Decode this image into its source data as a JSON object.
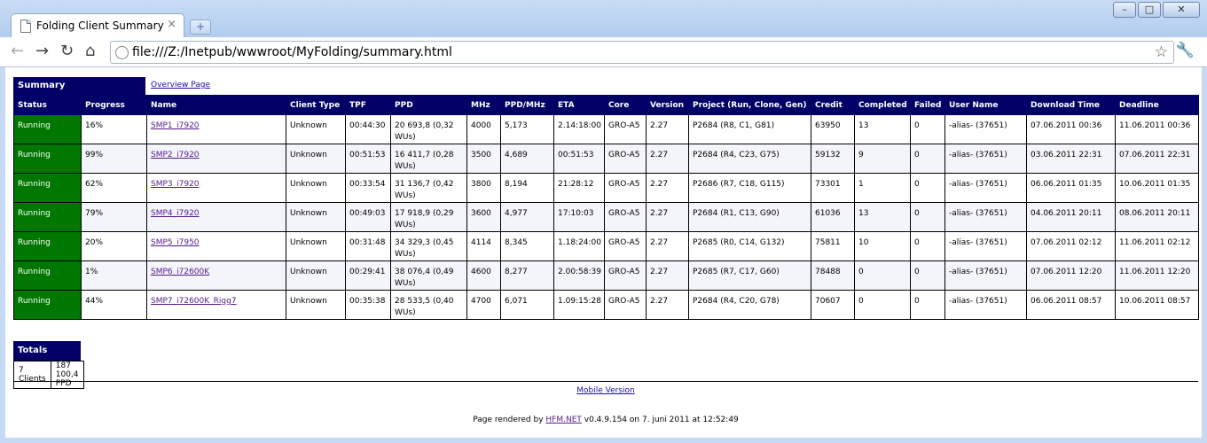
{
  "browser": {
    "tab_title": "Folding Client Summary",
    "tab_close": "×",
    "new_tab": "+",
    "url": "file:///Z:/Inetpub/wwwroot/MyFolding/summary.html",
    "icons": [
      "back-icon",
      "forward-icon",
      "reload-icon",
      "home-icon",
      "globe-icon",
      "star-icon",
      "wrench-icon"
    ]
  },
  "summary": {
    "title": "Summary",
    "overview_link": "Overview Page"
  },
  "columns": [
    "Status",
    "Progress",
    "Name",
    "Client Type",
    "TPF",
    "PPD",
    "MHz",
    "PPD/MHz",
    "ETA",
    "Core",
    "Version",
    "Project (Run, Clone, Gen)",
    "Credit",
    "Completed",
    "Failed",
    "User Name",
    "Download Time",
    "Deadline"
  ],
  "rows": [
    {
      "status": "Running",
      "progress": "16%",
      "name": "SMP1_i7920",
      "client_type": "Unknown",
      "tpf": "00:44:30",
      "ppd": "20 693,8 (0,32 WUs)",
      "mhz": "4000",
      "ppd_mhz": "5,173",
      "eta": "2.14:18:00",
      "core": "GRO-A5",
      "version": "2.27",
      "project": "P2684 (R8, C1, G81)",
      "credit": "63950",
      "completed": "13",
      "failed": "0",
      "user": "-alias- (37651)",
      "download": "07.06.2011 00:36",
      "deadline": "11.06.2011 00:36"
    },
    {
      "status": "Running",
      "progress": "99%",
      "name": "SMP2_i7920",
      "client_type": "Unknown",
      "tpf": "00:51:53",
      "ppd": "16 411,7 (0,28 WUs)",
      "mhz": "3500",
      "ppd_mhz": "4,689",
      "eta": "00:51:53",
      "core": "GRO-A5",
      "version": "2.27",
      "project": "P2684 (R4, C23, G75)",
      "credit": "59132",
      "completed": "9",
      "failed": "0",
      "user": "-alias- (37651)",
      "download": "03.06.2011 22:31",
      "deadline": "07.06.2011 22:31"
    },
    {
      "status": "Running",
      "progress": "62%",
      "name": "SMP3_i7920",
      "client_type": "Unknown",
      "tpf": "00:33:54",
      "ppd": "31 136,7 (0,42 WUs)",
      "mhz": "3800",
      "ppd_mhz": "8,194",
      "eta": "21:28:12",
      "core": "GRO-A5",
      "version": "2.27",
      "project": "P2686 (R7, C18, G115)",
      "credit": "73301",
      "completed": "1",
      "failed": "0",
      "user": "-alias- (37651)",
      "download": "06.06.2011 01:35",
      "deadline": "10.06.2011 01:35"
    },
    {
      "status": "Running",
      "progress": "79%",
      "name": "SMP4_i7920",
      "client_type": "Unknown",
      "tpf": "00:49:03",
      "ppd": "17 918,9 (0,29 WUs)",
      "mhz": "3600",
      "ppd_mhz": "4,977",
      "eta": "17:10:03",
      "core": "GRO-A5",
      "version": "2.27",
      "project": "P2684 (R1, C13, G90)",
      "credit": "61036",
      "completed": "13",
      "failed": "0",
      "user": "-alias- (37651)",
      "download": "04.06.2011 20:11",
      "deadline": "08.06.2011 20:11"
    },
    {
      "status": "Running",
      "progress": "20%",
      "name": "SMP5_i7950",
      "client_type": "Unknown",
      "tpf": "00:31:48",
      "ppd": "34 329,3 (0,45 WUs)",
      "mhz": "4114",
      "ppd_mhz": "8,345",
      "eta": "1.18:24:00",
      "core": "GRO-A5",
      "version": "2.27",
      "project": "P2685 (R0, C14, G132)",
      "credit": "75811",
      "completed": "10",
      "failed": "0",
      "user": "-alias- (37651)",
      "download": "07.06.2011 02:12",
      "deadline": "11.06.2011 02:12"
    },
    {
      "status": "Running",
      "progress": "1%",
      "name": "SMP6_i72600K",
      "client_type": "Unknown",
      "tpf": "00:29:41",
      "ppd": "38 076,4 (0,49 WUs)",
      "mhz": "4600",
      "ppd_mhz": "8,277",
      "eta": "2.00:58:39",
      "core": "GRO-A5",
      "version": "2.27",
      "project": "P2685 (R7, C17, G60)",
      "credit": "78488",
      "completed": "0",
      "failed": "0",
      "user": "-alias- (37651)",
      "download": "07.06.2011 12:20",
      "deadline": "11.06.2011 12:20"
    },
    {
      "status": "Running",
      "progress": "44%",
      "name": "SMP7_i72600K_Rigg7",
      "client_type": "Unknown",
      "tpf": "00:35:38",
      "ppd": "28 533,5 (0,40 WUs)",
      "mhz": "4700",
      "ppd_mhz": "6,071",
      "eta": "1.09:15:28",
      "core": "GRO-A5",
      "version": "2.27",
      "project": "P2684 (R4, C20, G78)",
      "credit": "70607",
      "completed": "0",
      "failed": "0",
      "user": "-alias- (37651)",
      "download": "06.06.2011 08:57",
      "deadline": "10.06.2011 08:57"
    }
  ],
  "totals": {
    "title": "Totals",
    "clients": "7 Clients",
    "ppd": "187 100,4 PPD"
  },
  "mobile_link": "Mobile Version",
  "footer": {
    "prefix": "Page rendered by",
    "link": "HFM.NET",
    "suffix": "v0.4.9.154 on 7. juni 2011 at 12:52:49"
  },
  "colors": {
    "header_bg": "#000066",
    "running": "#007700"
  }
}
